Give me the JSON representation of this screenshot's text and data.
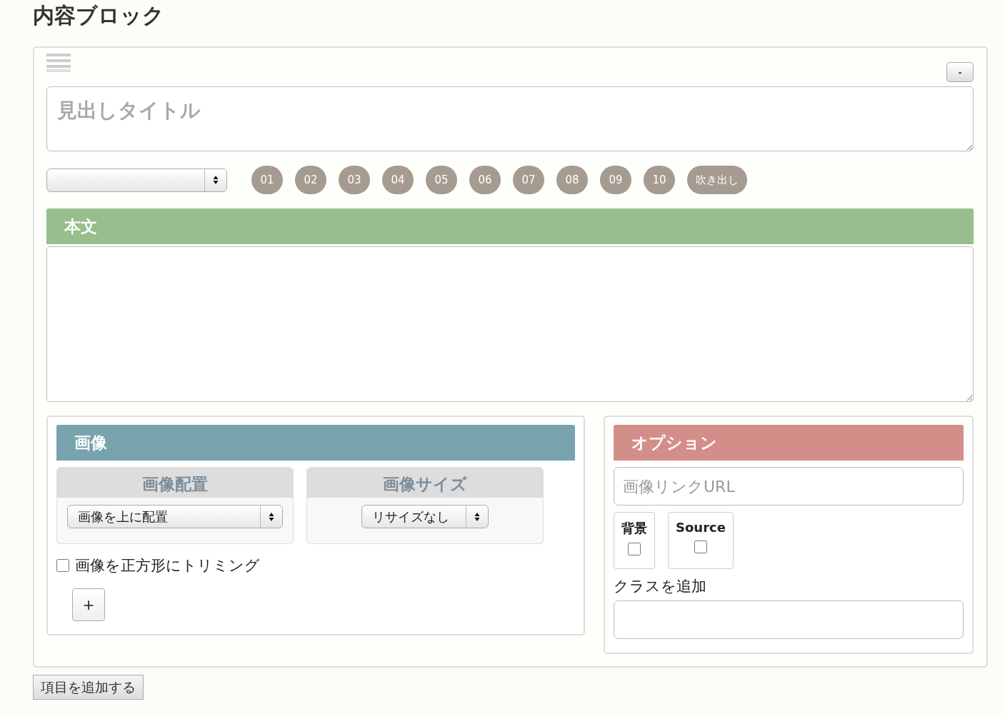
{
  "title": "内容ブロック",
  "block": {
    "collapse_button": "-",
    "heading_field": {
      "placeholder": "見出しタイトル"
    },
    "number_buttons": [
      "01",
      "02",
      "03",
      "04",
      "05",
      "06",
      "07",
      "08",
      "09",
      "10",
      "吹き出し"
    ],
    "body_section": {
      "label": "本文"
    },
    "image_panel": {
      "label": "画像",
      "placement": {
        "label": "画像配置",
        "value": "画像を上に配置"
      },
      "size": {
        "label": "画像サイズ",
        "value": "リサイズなし"
      },
      "square_trim": {
        "label": "画像を正方形にトリミング",
        "checked": false
      },
      "add_button": "+"
    },
    "option_panel": {
      "label": "オプション",
      "link_field": {
        "placeholder": "画像リンクURL"
      },
      "toggles": [
        {
          "label": "背景",
          "checked": false
        },
        {
          "label": "Source",
          "checked": false
        }
      ],
      "class_label": "クラスを追加"
    }
  },
  "add_item_button": "項目を追加する"
}
